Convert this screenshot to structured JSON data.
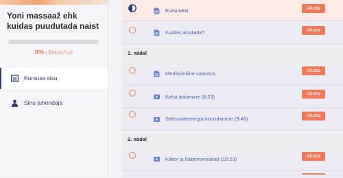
{
  "sidebar": {
    "course_title": "Yoni massaaž ehk kuidas puudutada naist",
    "progress": {
      "percent_value": 0,
      "percent_label": "0%",
      "label": "LÕPETATUD"
    },
    "nav": [
      {
        "label": "Kursuse sisu",
        "icon": "list-icon",
        "active": true
      },
      {
        "label": "Sinu juhendaja",
        "icon": "user-icon",
        "active": false
      }
    ]
  },
  "curriculum": {
    "intro": [
      {
        "title": "Kursusest",
        "type": "document",
        "status": "in-progress",
        "button": "Alusta"
      },
      {
        "title": "Kuidas alustada?",
        "type": "document",
        "status": "not-started",
        "button": "Alusta"
      }
    ],
    "week1": {
      "label": "1. nädal",
      "lessons": [
        {
          "title": "Meditsiiniline vastutus",
          "type": "document",
          "button": "Alusta"
        },
        {
          "title": "Keha ärkamine (8:29)",
          "type": "video",
          "button": "Alusta"
        },
        {
          "title": "Seksuaalenergia koondamine (9:46)",
          "type": "video",
          "button": "Alusta"
        }
      ]
    },
    "week2": {
      "label": "2. nädal",
      "lessons": [
        {
          "title": "Kliitor ja häbememokad (10:23)",
          "type": "video",
          "button": "Alusta"
        }
      ]
    }
  },
  "colors": {
    "accent": "#ef7a5a",
    "navy": "#2c3e73",
    "link": "#4a62b0",
    "current_row": "#fcebe6",
    "row_bg": "#ececf2"
  }
}
